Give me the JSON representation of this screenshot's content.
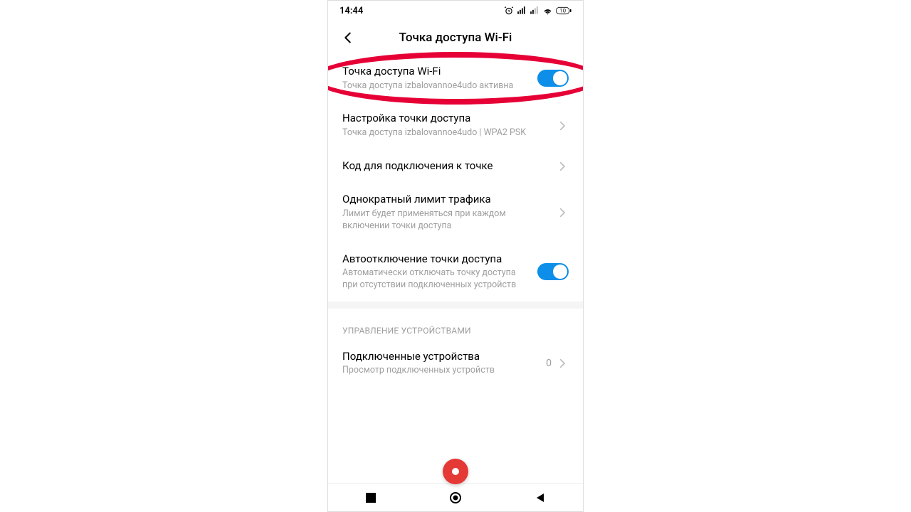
{
  "status": {
    "time": "14:44",
    "battery": "10"
  },
  "header": {
    "title": "Точка доступа Wi-Fi"
  },
  "rows": {
    "hotspot_toggle": {
      "title": "Точка доступа Wi-Fi",
      "subtitle": "Точка доступа izbalovannoe4udo активна"
    },
    "hotspot_setup": {
      "title": "Настройка точки доступа",
      "subtitle": "Точка доступа izbalovannoe4udo | WPA2 PSK"
    },
    "connect_code": {
      "title": "Код для подключения к точке"
    },
    "one_time_limit": {
      "title": "Однократный лимит трафика",
      "subtitle": "Лимит будет применяться при каждом включении точки доступа"
    },
    "auto_off": {
      "title": "Автоотключение точки доступа",
      "subtitle": "Автоматически отключать точку доступа при отсутствии подключенных устройств"
    },
    "connected": {
      "title": "Подключенные устройства",
      "subtitle": "Просмотр подключенных устройств",
      "count": "0"
    }
  },
  "sections": {
    "device_mgmt": "УПРАВЛЕНИЕ УСТРОЙСТВАМИ"
  }
}
